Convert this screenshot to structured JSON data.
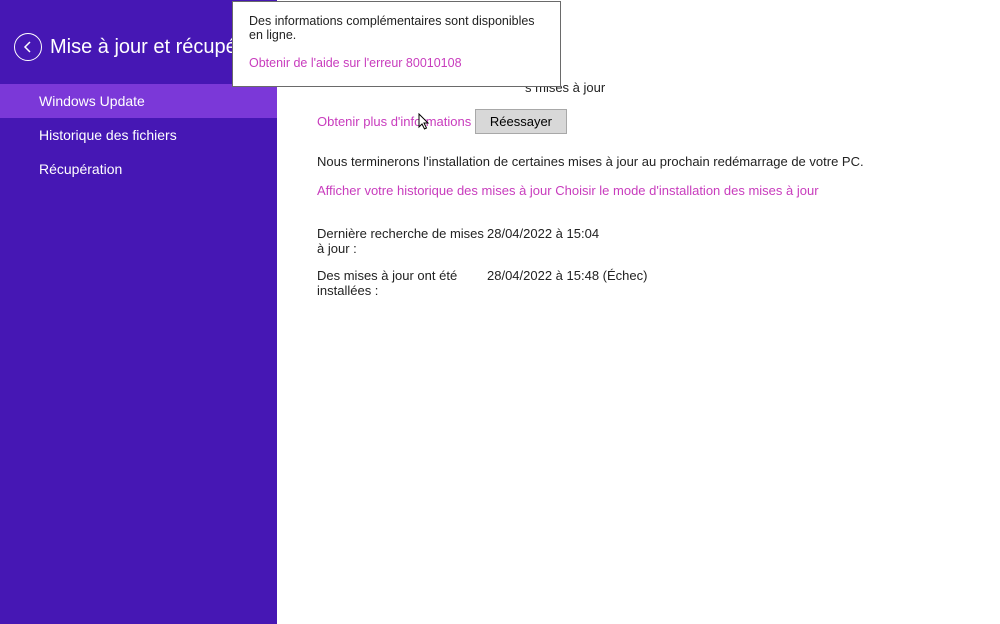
{
  "header": {
    "title": "Mise à jour et récupérati..."
  },
  "sidebar": {
    "items": [
      {
        "label": "Windows Update"
      },
      {
        "label": "Historique des fichiers"
      },
      {
        "label": "Récupération"
      }
    ]
  },
  "tooltip": {
    "text": "Des informations complémentaires sont disponibles en ligne.",
    "link": "Obtenir de l'aide sur l'erreur 80010108"
  },
  "main": {
    "partial_visible_text": "s mises à jour",
    "more_info_link": "Obtenir plus d'informations",
    "retry_btn": "Réessayer",
    "restart_text": "Nous terminerons l'installation de certaines mises à jour au prochain redémarrage de votre PC.",
    "history_link": "Afficher votre historique des mises à jour",
    "choose_mode_link": "Choisir le mode d'installation des mises à jour",
    "last_check_label": "Dernière recherche de mises à jour :",
    "last_check_value": "28/04/2022 à 15:04",
    "last_install_label": "Des mises à jour ont été installées :",
    "last_install_value": "28/04/2022 à 15:48 (Échec)"
  },
  "colors": {
    "accent_purple": "#4617b4",
    "active_purple": "#7b38d8",
    "link_magenta": "#c83cbd"
  }
}
